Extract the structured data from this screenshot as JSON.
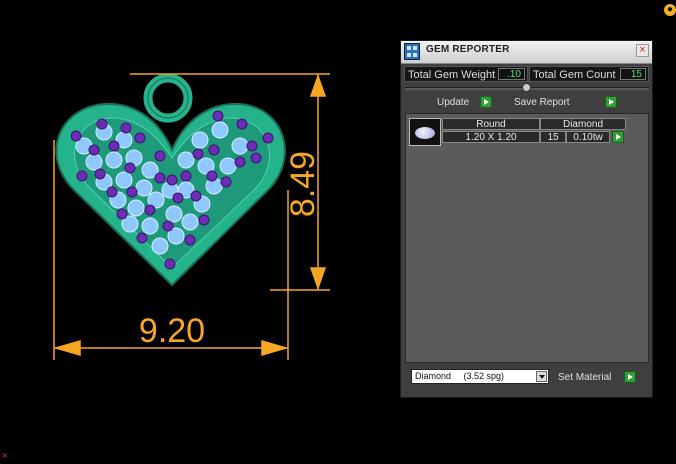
{
  "drawing": {
    "dimension_height": "8.49",
    "dimension_width": "9.20"
  },
  "panel": {
    "title": "GEM REPORTER",
    "total_gem_weight_label": "Total Gem Weight",
    "total_gem_weight_value": ".10",
    "total_gem_count_label": "Total Gem Count",
    "total_gem_count_value": "15",
    "update_label": "Update",
    "save_report_label": "Save Report",
    "table": {
      "shape_header": "Round",
      "material_header": "Diamond",
      "size": "1.20 X 1.20",
      "count": "15",
      "weight": "0.10tw"
    },
    "material_select": "Diamond     (3.52 spg)",
    "set_material_label": "Set Material"
  },
  "colors": {
    "metal": "#25b38c",
    "stone_large": "#8ec8ff",
    "stone_small": "#6a2db3",
    "dimension": "#f6a623",
    "value_text": "#4fe07b"
  }
}
